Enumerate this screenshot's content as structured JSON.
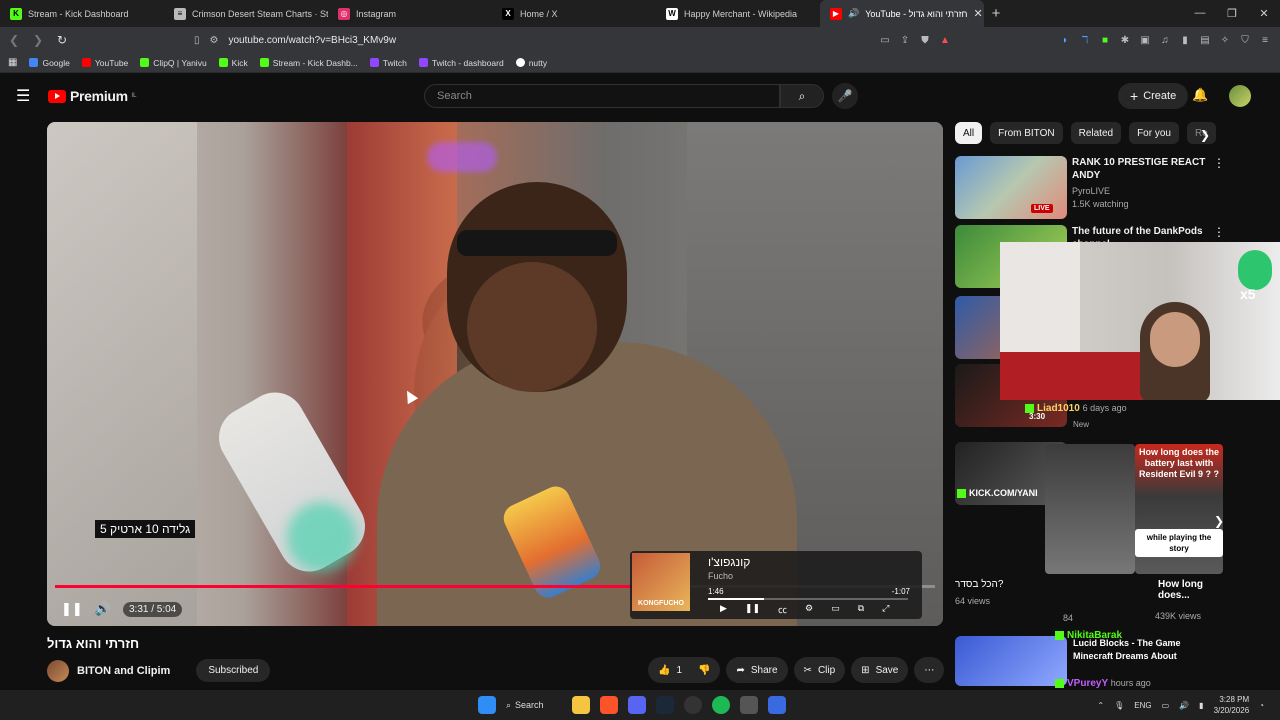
{
  "browser": {
    "tabs": [
      {
        "label": "Stream - Kick Dashboard",
        "icon": "kick-icon",
        "color": "#53fc18"
      },
      {
        "label": "Crimson Desert Steam Charts · Steam",
        "icon": "steamcharts-icon",
        "color": "#bbbbbb"
      },
      {
        "label": "Instagram",
        "icon": "instagram-icon",
        "color": "#e1306c"
      },
      {
        "label": "Home / X",
        "icon": "x-icon",
        "color": "#ffffff"
      },
      {
        "label": "Happy Merchant - Wikipedia",
        "icon": "wikipedia-icon",
        "color": "#ffffff"
      },
      {
        "label": "YouTube - חזרתי והוא גדול",
        "icon": "youtube-icon",
        "color": "#ff0000",
        "active": true
      }
    ],
    "url": "youtube.com/watch?v=BHci3_KMv9w",
    "bookmarks": [
      {
        "label": "Google",
        "color": "#4285f4"
      },
      {
        "label": "YouTube",
        "color": "#ff0000"
      },
      {
        "label": "ClipQ | Yanivu",
        "color": "#53fc18"
      },
      {
        "label": "Kick",
        "color": "#53fc18"
      },
      {
        "label": "Stream - Kick Dashb...",
        "color": "#53fc18"
      },
      {
        "label": "Twitch",
        "color": "#9146ff"
      },
      {
        "label": "Twitch - dashboard",
        "color": "#9146ff"
      },
      {
        "label": "nutty",
        "color": "#ffffff"
      }
    ]
  },
  "youtube": {
    "logo_text": "Premium",
    "logo_region": "IL",
    "search_placeholder": "Search",
    "create_label": "Create"
  },
  "video": {
    "caption_tag": "גלידה 10 ארטיק 5",
    "time": "3:31 / 5:04",
    "progress": 0.695,
    "title": "חזרתי והוא גדול",
    "channel": "BITON and Clipim",
    "subscribed_label": "Subscribed",
    "likes": "1",
    "share_label": "Share",
    "clip_label": "Clip",
    "save_label": "Save"
  },
  "spotify": {
    "song": "קונגפוצ'ו",
    "artist": "Fucho",
    "elapsed": "1:46",
    "remaining": "-1:07",
    "art_text": "KONGFUCHO",
    "progress": 0.28
  },
  "chips": [
    "All",
    "From BITON",
    "Related",
    "For you",
    "Re"
  ],
  "related": [
    {
      "title": "RANK 10 PRESTIGE REACT ANDY",
      "channel": "PyroLIVE",
      "meta": "1.5K watching",
      "live": "LIVE"
    },
    {
      "title": "The future of the DankPods channel",
      "channel": "",
      "meta": ""
    }
  ],
  "overlay_chat": {
    "l1_user": "Liad1010",
    "l1_meta": "6 days ago",
    "l1_new": "New",
    "l1_time": "3:30",
    "kick_url": "KICK.COM/YANI",
    "q_text": "How long does the battery last with Resident Evil 9 ? ?",
    "while_text": "while playing the story",
    "views_a": "64 views",
    "views_b": "439K views",
    "how_long": "How long does...",
    "u_nikita": "NikitaBarak",
    "u_lucid": "Lucid Blocks - The Game",
    "u_mc": "Minecraft Dreams About",
    "u_vpurey": "VPureyY",
    "hours": "hours ago",
    "hebrew_a": "הכל בסדר?",
    "count": "84"
  },
  "taskbar": {
    "search_label": "Search",
    "lang": "ENG",
    "time": "3:28 PM",
    "date": "3/20/2026"
  }
}
